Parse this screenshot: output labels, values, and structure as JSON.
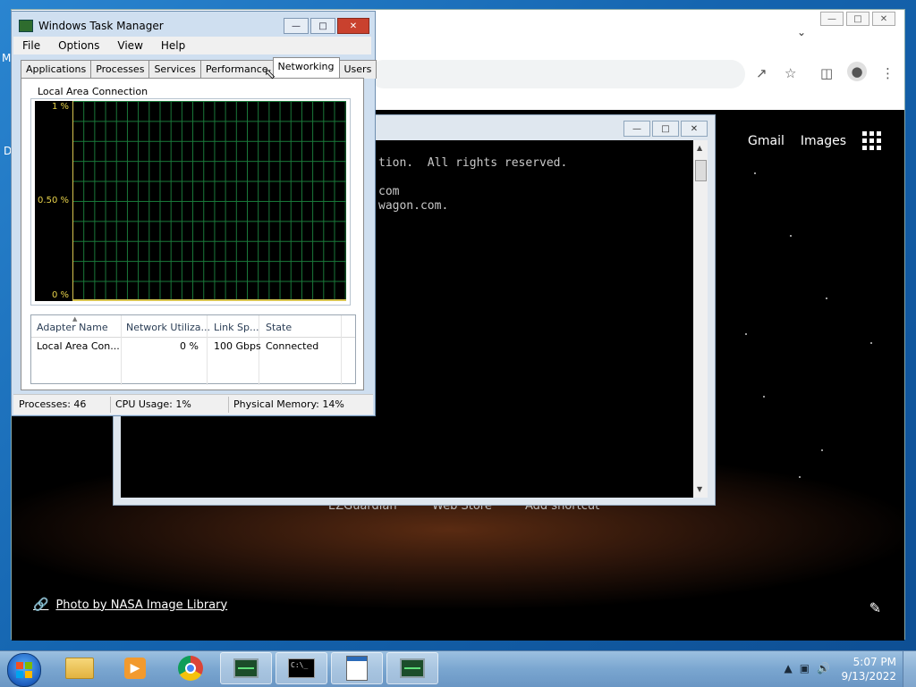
{
  "desktop": {
    "letters": [
      "M",
      "D"
    ]
  },
  "chrome": {
    "header_links": [
      "Gmail",
      "Images"
    ],
    "shortcuts": [
      "EZGuardian",
      "Web Store",
      "Add shortcut"
    ],
    "photo_credit": "Photo by NASA Image Library",
    "icons": [
      "share-icon",
      "star-icon",
      "sidepanel-icon",
      "profile-icon",
      "menu-icon",
      "apps-icon",
      "pencil-icon",
      "link-icon"
    ]
  },
  "console": {
    "lines": [
      "tion.  All rights reserved.",
      "com",
      "wagon.com."
    ]
  },
  "taskmgr": {
    "title": "Windows Task Manager",
    "menu": [
      "File",
      "Options",
      "View",
      "Help"
    ],
    "tabs": [
      "Applications",
      "Processes",
      "Services",
      "Performance",
      "Networking",
      "Users"
    ],
    "active_tab": "Networking",
    "group_label": "Local Area Connection",
    "graph": {
      "y_labels": [
        "1 %",
        "0.50 %",
        "0 %"
      ],
      "ymax_percent": 1,
      "grid": true
    },
    "table": {
      "headers": [
        "Adapter Name",
        "Network Utiliza...",
        "Link Sp...",
        "State"
      ],
      "rows": [
        [
          "Local Area Con...",
          "0 %",
          "100 Gbps",
          "Connected"
        ]
      ]
    },
    "status": {
      "processes": "Processes: 46",
      "cpu": "CPU Usage: 1%",
      "memory": "Physical Memory: 14%"
    }
  },
  "taskbar": {
    "time": "5:07 PM",
    "date": "9/13/2022"
  }
}
